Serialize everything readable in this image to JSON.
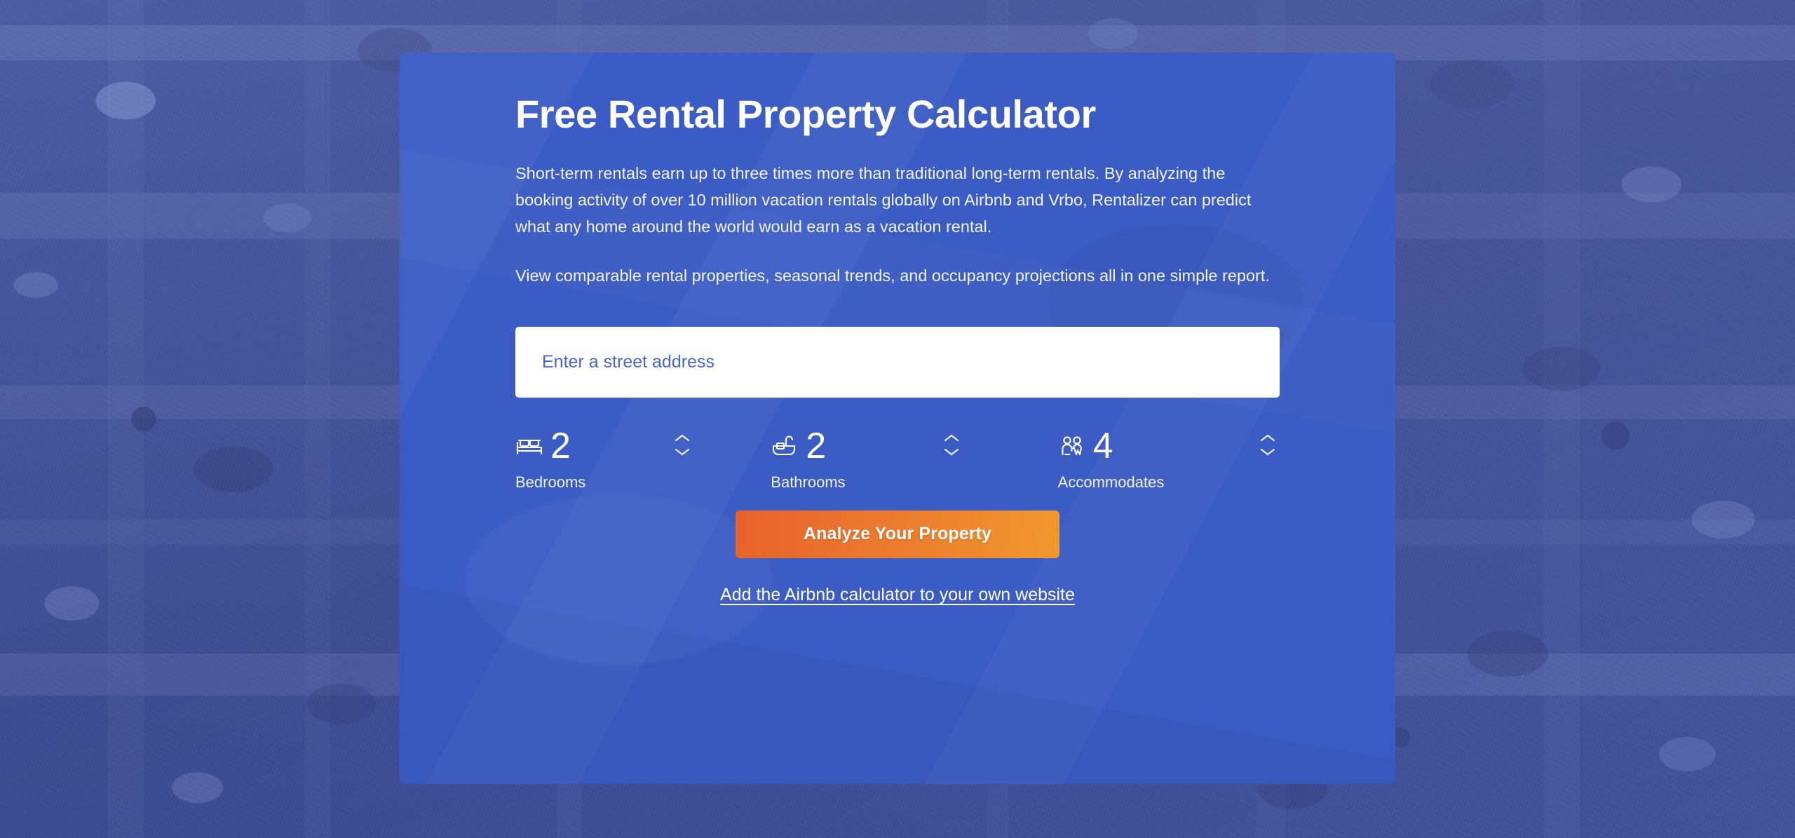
{
  "background": {
    "description": "aerial-neighborhood-photo",
    "tint_color": "#3b5cc4"
  },
  "card": {
    "background_color": "#3b5cc4",
    "title": "Free Rental Property Calculator",
    "paragraphs": [
      "Short-term rentals earn up to three times more than traditional long-term rentals. By analyzing the booking activity of over 10 million vacation rentals globally on Airbnb and Vrbo, Rentalizer can predict what any home around the world would earn as a vacation rental.",
      "View comparable rental properties, seasonal trends, and occupancy projections all in one simple report."
    ],
    "address_input": {
      "placeholder": "Enter a street address",
      "value": ""
    },
    "specs": [
      {
        "icon": "bed-icon",
        "value": "2",
        "label": "Bedrooms",
        "stepper": "stepper-bedrooms"
      },
      {
        "icon": "bath-icon",
        "value": "2",
        "label": "Bathrooms",
        "stepper": "stepper-bathrooms"
      },
      {
        "icon": "people-icon",
        "value": "4",
        "label": "Accommodates",
        "stepper": "stepper-accommodates"
      }
    ],
    "cta": {
      "label": "Analyze Your Property",
      "gradient_start": "#e8622c",
      "gradient_end": "#f0982f"
    },
    "embed_link": "Add the Airbnb calculator to your own website"
  }
}
